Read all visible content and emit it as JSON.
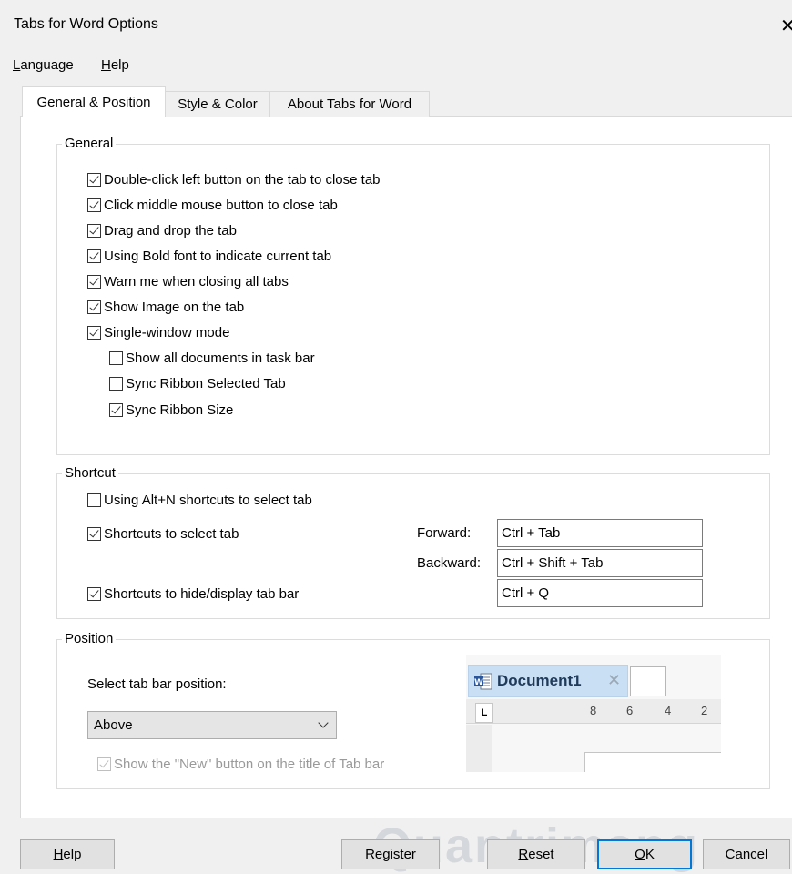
{
  "window": {
    "title": "Tabs for Word Options",
    "close_glyph": "✕"
  },
  "menu": {
    "language": {
      "mnemonic": "L",
      "rest": "anguage"
    },
    "help": {
      "mnemonic": "H",
      "rest": "elp"
    }
  },
  "tabs": [
    {
      "label": "General & Position",
      "active": true
    },
    {
      "label": "Style & Color",
      "active": false
    },
    {
      "label": "About Tabs for Word",
      "active": false
    }
  ],
  "general": {
    "title": "General",
    "options": [
      {
        "label": "Double-click left button on the tab to close tab",
        "checked": true
      },
      {
        "label": "Click middle mouse button to close tab",
        "checked": true
      },
      {
        "label": "Drag and drop the tab",
        "checked": true
      },
      {
        "label": "Using Bold font to indicate current tab",
        "checked": true
      },
      {
        "label": "Warn me when closing all tabs",
        "checked": true
      },
      {
        "label": "Show Image on the tab",
        "checked": true
      },
      {
        "label": "Single-window mode",
        "checked": true
      },
      {
        "label": "Show all documents in task bar",
        "checked": false
      },
      {
        "label": "Sync Ribbon Selected Tab",
        "checked": false
      },
      {
        "label": "Sync Ribbon Size",
        "checked": true
      }
    ]
  },
  "shortcut": {
    "title": "Shortcut",
    "alt_n": {
      "label": "Using Alt+N shortcuts to select tab",
      "checked": false
    },
    "select_tab": {
      "label": "Shortcuts to select tab",
      "checked": true
    },
    "hide_display": {
      "label": "Shortcuts to hide/display tab bar",
      "checked": true
    },
    "forward_label": "Forward:",
    "forward_value": "Ctrl + Tab",
    "backward_label": "Backward:",
    "backward_value": "Ctrl + Shift + Tab",
    "toggle_value": "Ctrl + Q"
  },
  "position": {
    "title": "Position",
    "select_label": "Select tab bar position:",
    "selected": "Above",
    "show_new": {
      "label": "Show the \"New\" button on the title of Tab bar",
      "checked": true,
      "disabled": true
    }
  },
  "preview": {
    "doc_title": "Document1",
    "close_glyph": "✕",
    "ruler_marker": "L",
    "ruler_numbers": [
      "8",
      "6",
      "4",
      "2"
    ]
  },
  "buttons": {
    "help": {
      "mnemonic": "H",
      "rest": "elp"
    },
    "register": {
      "label": "Register"
    },
    "reset": {
      "mnemonic": "R",
      "rest": "eset"
    },
    "ok": {
      "mnemonic": "O",
      "rest": "K"
    },
    "cancel": {
      "label": "Cancel"
    }
  },
  "watermark": "Quantrimang",
  "colors": {
    "accent": "#0078d7",
    "doc_tab": "#c9dff3",
    "word_blue": "#2b579a"
  }
}
